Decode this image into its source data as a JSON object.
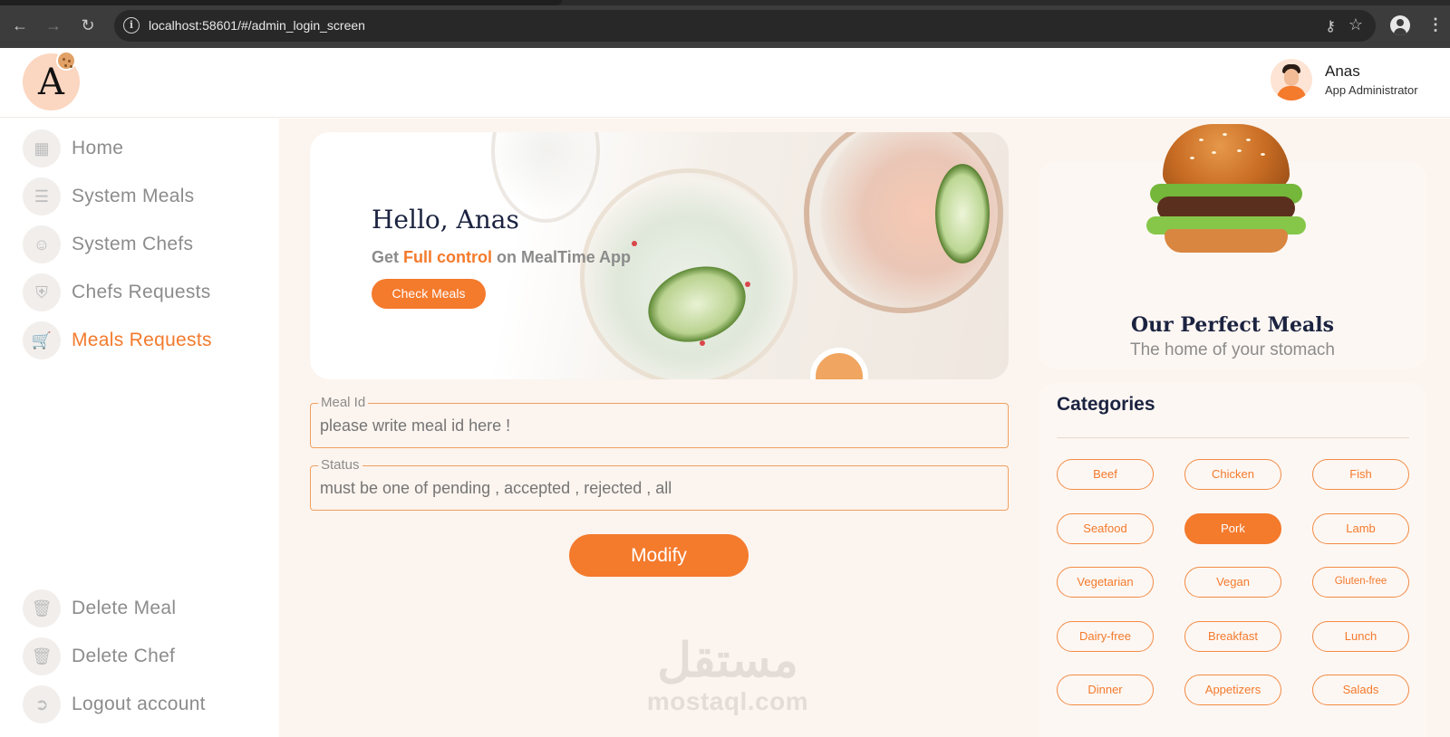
{
  "browser": {
    "url": "localhost:58601/#/admin_login_screen",
    "back_icon": "arrow-left-icon",
    "forward_icon": "arrow-right-icon",
    "reload_icon": "reload-icon",
    "menu_icon": "kebab-menu-icon"
  },
  "header": {
    "logo_letter": "A",
    "user_name": "Anas",
    "user_role": "App Administrator"
  },
  "sidebar": {
    "items": [
      {
        "label": "Home",
        "icon": "grid-icon"
      },
      {
        "label": "System Meals",
        "icon": "burger-icon"
      },
      {
        "label": "System Chefs",
        "icon": "users-icon"
      },
      {
        "label": "Chefs Requests",
        "icon": "shield-icon"
      },
      {
        "label": "Meals Requests",
        "icon": "cart-icon",
        "active": true
      }
    ],
    "bottom_items": [
      {
        "label": "Delete Meal",
        "icon": "trash-icon"
      },
      {
        "label": "Delete Chef",
        "icon": "trash-icon"
      },
      {
        "label": "Logout account",
        "icon": "logout-icon"
      }
    ]
  },
  "hero": {
    "title": "Hello, Anas",
    "subtitle_pre": "Get ",
    "subtitle_accent": "Full control",
    "subtitle_post": " on MealTime App",
    "button": "Check Meals"
  },
  "form": {
    "meal_id_label": "Meal Id",
    "meal_id_placeholder": "please write meal id here !",
    "status_label": "Status",
    "status_placeholder": "must be one of pending , accepted , rejected , all",
    "submit": "Modify"
  },
  "promo": {
    "title": "Our Perfect Meals",
    "subtitle": "The home of your stomach"
  },
  "categories": {
    "title": "Categories",
    "items": [
      "Beef",
      "Chicken",
      "Fish",
      "Seafood",
      "Pork",
      "Lamb",
      "Vegetarian",
      "Vegan",
      "Gluten-free",
      "Dairy-free",
      "Breakfast",
      "Lunch",
      "Dinner",
      "Appetizers",
      "Salads"
    ],
    "selected": "Pork"
  },
  "watermark": {
    "arabic": "مستقل",
    "latin": "mostaql.com"
  },
  "colors": {
    "accent": "#f47a2c",
    "background": "#fcf4ee",
    "heading": "#1b2340"
  }
}
